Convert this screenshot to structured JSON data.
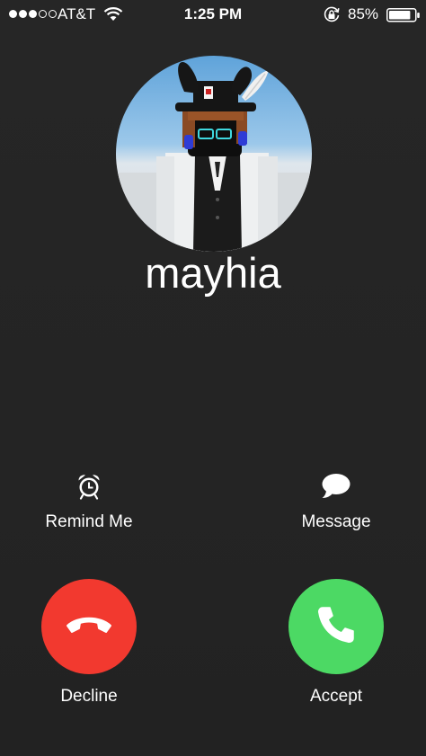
{
  "status_bar": {
    "signal_filled": 3,
    "signal_total": 5,
    "carrier": "AT&T",
    "time": "1:25 PM",
    "battery_percent": "85%",
    "battery_level": 0.85
  },
  "caller": {
    "name": "mayhia",
    "avatar": "roblox-avatar-image"
  },
  "actions": {
    "remind_me": {
      "label": "Remind Me",
      "icon": "alarm-clock-icon"
    },
    "message": {
      "label": "Message",
      "icon": "speech-bubble-icon"
    },
    "decline": {
      "label": "Decline",
      "icon": "phone-hangup-icon"
    },
    "accept": {
      "label": "Accept",
      "icon": "phone-icon"
    }
  },
  "colors": {
    "background": "#242424",
    "decline": "#f2392f",
    "accept": "#4cd964",
    "text": "#ffffff"
  }
}
